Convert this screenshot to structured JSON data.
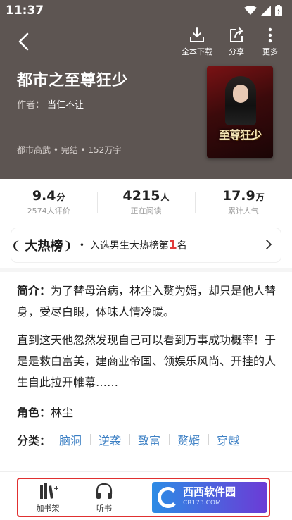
{
  "status": {
    "time": "11:37"
  },
  "header": {
    "actions": [
      {
        "label": "全本下载",
        "icon": "download-icon"
      },
      {
        "label": "分享",
        "icon": "share-icon"
      },
      {
        "label": "更多",
        "icon": "more-vertical-icon"
      }
    ],
    "title": "都市之至尊狂少",
    "author_prefix": "作者：",
    "author": "当仁不让",
    "meta": "都市高武 • 完结 • 152万字",
    "cover_title": "至尊狂少"
  },
  "stats": [
    {
      "value": "9.4",
      "unit": "分",
      "label": "2574人评价"
    },
    {
      "value": "4215",
      "unit": "人",
      "label": "正在阅读"
    },
    {
      "value": "17.9",
      "unit": "万",
      "label": "累计人气"
    }
  ],
  "rank": {
    "badge": "大热榜",
    "text_before": "入选男生大热榜第",
    "number": "1",
    "text_after": "名"
  },
  "intro": {
    "label": "简介：",
    "p1": "为了替母治病，林尘入赘为婿，却只是他人替身，受尽白眼，体味人情冷暖。",
    "p2": "直到这天他忽然发现自己可以看到万事成功概率！于是是救白富美，建商业帝国、领娱乐风尚、开挂的人生自此拉开帷幕……"
  },
  "role": {
    "label": "角色：",
    "value": "林尘"
  },
  "categories": {
    "label": "分类：",
    "tags": [
      "脑洞",
      "逆袭",
      "致富",
      "赘婿",
      "穿越"
    ]
  },
  "bottom": {
    "shelf_label": "加书架",
    "listen_label": "听书",
    "watermark_text": "西西软件园",
    "watermark_sub": "CR173.COM"
  }
}
